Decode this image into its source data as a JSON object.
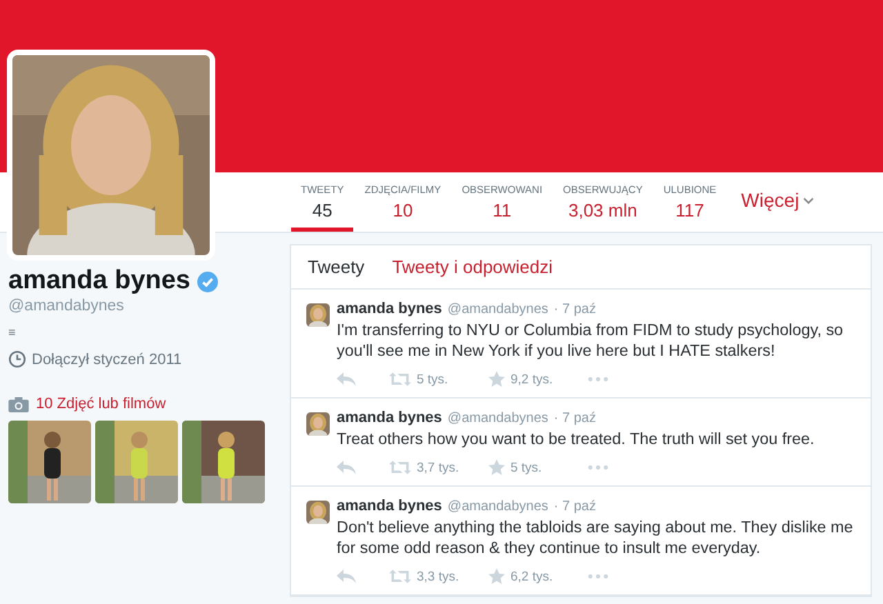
{
  "profile": {
    "name": "amanda bynes",
    "handle": "@amandabynes",
    "verified": true,
    "bio": "≡",
    "joined": "Dołączył styczeń 2011",
    "media_link": "10 Zdjęć lub filmów"
  },
  "nav": {
    "tabs": [
      {
        "label": "TWEETY",
        "value": "45",
        "selected": true
      },
      {
        "label": "ZDJĘCIA/FILMY",
        "value": "10",
        "selected": false
      },
      {
        "label": "OBSERWOWANI",
        "value": "11",
        "selected": false
      },
      {
        "label": "OBSERWUJĄCY",
        "value": "3,03 mln",
        "selected": false
      },
      {
        "label": "ULUBIONE",
        "value": "117",
        "selected": false
      }
    ],
    "more": "Więcej"
  },
  "timeline": {
    "tabs": [
      {
        "label": "Tweety",
        "selected": true
      },
      {
        "label": "Tweety i odpowiedzi",
        "selected": false
      }
    ],
    "tweets": [
      {
        "name": "amanda bynes",
        "handle": "@amandabynes",
        "time": "· 7 paź",
        "text": "I'm transferring to NYU or Columbia from FIDM to study psychology, so you'll see me in New York if you live here but I HATE stalkers!",
        "retweets": "5 tys.",
        "favorites": "9,2 tys."
      },
      {
        "name": "amanda bynes",
        "handle": "@amandabynes",
        "time": "· 7 paź",
        "text": "Treat others how you want to be treated.  The truth will set you free.",
        "retweets": "3,7 tys.",
        "favorites": "5 tys."
      },
      {
        "name": "amanda bynes",
        "handle": "@amandabynes",
        "time": "· 7 paź",
        "text": "Don't believe anything the tabloids are saying about me. They dislike me for some odd reason & they continue to insult me everyday.",
        "retweets": "3,3 tys.",
        "favorites": "6,2 tys."
      }
    ]
  }
}
